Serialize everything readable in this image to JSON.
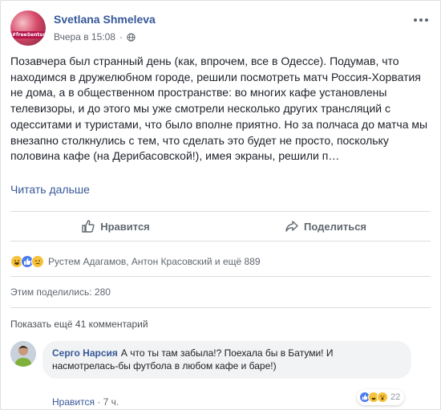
{
  "post": {
    "author": "Svetlana Shmeleva",
    "time": "Вчера в 15:08",
    "separator": "·",
    "avatar_tag": "#freeSentsov",
    "text": "Позавчера был странный день (как, впрочем, все в Одессе). Подумав, что находимся в дружелюбном городе, решили посмотреть матч Россия-Хорватия не дома, а в общественном пространстве: во многих кафе установлены телевизоры, и до этого мы уже смотрели несколько других трансляций с одесситами и туристами, что было вполне приятно. Но за полчаса до матча мы внезапно столкнулись с тем, что сделать это будет не просто, поскольку половина кафе (на Дерибасовской!), имея экраны, решили п…",
    "see_more": "Читать дальше"
  },
  "actions": {
    "like": "Нравится",
    "share": "Поделиться"
  },
  "reactions": {
    "names": "Рустем Адагамов, Антон Красовский и ещё 889"
  },
  "shares": "Этим поделились: 280",
  "more_comments": "Показать ещё 41 комментарий",
  "comment": {
    "author": "Серго Нарсия",
    "text": "А что ты там забыла!? Поехала бы в Батуми! И насмотрелась-бы футбола в любом кафе и баре!)",
    "reaction_count": "22",
    "like_link": "Нравится",
    "dot": " · ",
    "time": "7 ч."
  },
  "colors": {
    "link": "#385898",
    "like_reaction": "#4b7cf0",
    "emoji_yellow": "#f7c23b"
  }
}
